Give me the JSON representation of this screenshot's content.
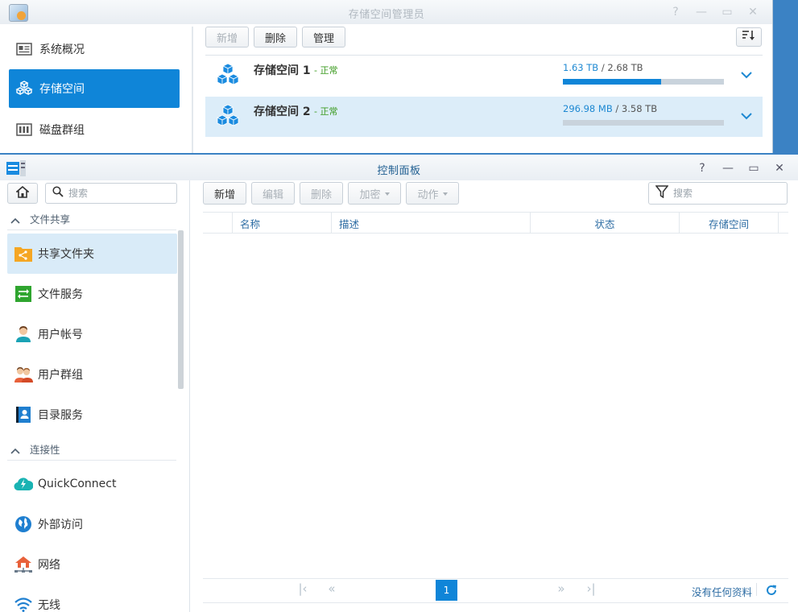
{
  "storage_manager": {
    "title": "存储空间管理员",
    "nav": [
      {
        "label": "系统概况",
        "icon": "overview-icon"
      },
      {
        "label": "存储空间",
        "icon": "storage-cubes-icon"
      },
      {
        "label": "磁盘群组",
        "icon": "disk-group-icon"
      }
    ],
    "toolbar": {
      "create": "新增",
      "delete": "删除",
      "manage": "管理"
    },
    "volumes": [
      {
        "name": "存储空间 1",
        "status": "- 正常",
        "used": "1.63 TB",
        "total": " / 2.68 TB",
        "usage_fraction": 0.608
      },
      {
        "name": "存储空间 2",
        "status": "- 正常",
        "used": "296.98 MB",
        "total": " / 3.58 TB",
        "usage_fraction": 0.0
      }
    ],
    "colors": {
      "accent": "#0f85d8",
      "status_ok": "#3a9a1e"
    }
  },
  "control_panel": {
    "title": "控制面板",
    "search_placeholder": "搜索",
    "categories": [
      {
        "label": "文件共享",
        "items": [
          {
            "label": "共享文件夹",
            "icon": "shared-folder-icon"
          },
          {
            "label": "文件服务",
            "icon": "file-services-icon"
          },
          {
            "label": "用户帐号",
            "icon": "user-icon"
          },
          {
            "label": "用户群组",
            "icon": "group-icon"
          },
          {
            "label": "目录服务",
            "icon": "directory-icon"
          }
        ]
      },
      {
        "label": "连接性",
        "items": [
          {
            "label": "QuickConnect",
            "icon": "quickconnect-icon"
          },
          {
            "label": "外部访问",
            "icon": "globe-icon"
          },
          {
            "label": "网络",
            "icon": "network-icon"
          },
          {
            "label": "无线",
            "icon": "wifi-icon"
          }
        ]
      }
    ],
    "toolbar": {
      "create": "新增",
      "edit": "编辑",
      "delete": "删除",
      "encrypt": "加密",
      "action": "动作"
    },
    "filter_placeholder": "搜索",
    "columns": [
      "名称",
      "描述",
      "状态",
      "存储空间"
    ],
    "pager": {
      "current_page": "1",
      "no_data": "没有任何资料"
    }
  }
}
